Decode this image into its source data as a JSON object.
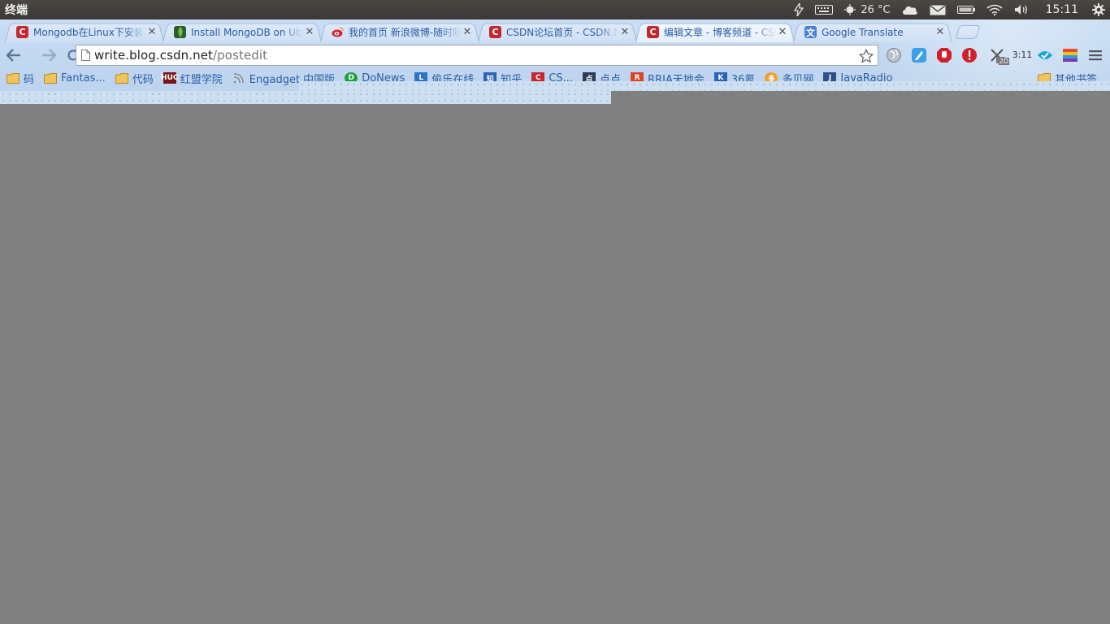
{
  "panel": {
    "app_title": "终端",
    "temperature": "26 °C",
    "clock": "15:11",
    "icons": [
      "power-flash-icon",
      "keyboard-icon",
      "sun-icon",
      "cloud-icon",
      "mail-icon",
      "battery-icon",
      "wifi-icon",
      "volume-icon",
      "gear-icon"
    ]
  },
  "tabs": [
    {
      "title": "Mongodb在Linux下安装及",
      "favicon": "csdn-icon",
      "favicon_color": "#c6262e",
      "active": false
    },
    {
      "title": "Install MongoDB on Ubun",
      "favicon": "mongodb-leaf-icon",
      "favicon_color": "#2e5e2a",
      "active": false
    },
    {
      "title": "我的首页 新浪微博-随时随",
      "favicon": "weibo-icon",
      "favicon_color": "#e6162d",
      "active": false
    },
    {
      "title": "CSDN论坛首页 - CSDN.NE",
      "favicon": "csdn-icon",
      "favicon_color": "#c6262e",
      "active": false
    },
    {
      "title": "编辑文章 - 博客频道 - CSD",
      "favicon": "csdn-icon",
      "favicon_color": "#c6262e",
      "active": true
    },
    {
      "title": "Google Translate",
      "favicon": "translate-icon",
      "favicon_color": "#4a7fd0",
      "active": false
    }
  ],
  "toolbar": {
    "url_host": "write.blog.csdn.net",
    "url_path": "/postedit",
    "ext_badge": "3:11",
    "ext_badge_2d": "2D"
  },
  "bookmarks": [
    {
      "label": "码",
      "icon": "folder-icon"
    },
    {
      "label": "Fantas...",
      "icon": "folder-icon"
    },
    {
      "label": "代码",
      "icon": "folder-icon"
    },
    {
      "label": "红盟学院",
      "icon": "huc-icon",
      "icon_text": "HUC"
    },
    {
      "label": "Engadget 中国版",
      "icon": "rss-icon"
    },
    {
      "label": "DoNews",
      "icon": "donews-icon"
    },
    {
      "label": "偷乐在线",
      "icon": "page-icon"
    },
    {
      "label": "知乎",
      "icon": "zhihu-icon"
    },
    {
      "label": "CS...",
      "icon": "csdn-icon"
    },
    {
      "label": "点点",
      "icon": "diandian-icon"
    },
    {
      "label": "RRIA天地会",
      "icon": "rria-icon"
    },
    {
      "label": "36氪",
      "icon": "36kr-icon"
    },
    {
      "label": "多贝网",
      "icon": "duobei-icon"
    },
    {
      "label": "JavaRadio",
      "icon": "javaradio-icon"
    }
  ],
  "bookmarks_other": "其他书签",
  "colors": {
    "panel_bg": "#3c3b37",
    "chrome_bg": "#c3d8f1",
    "content_bg": "#808080",
    "link_blue": "#2a5da8"
  }
}
